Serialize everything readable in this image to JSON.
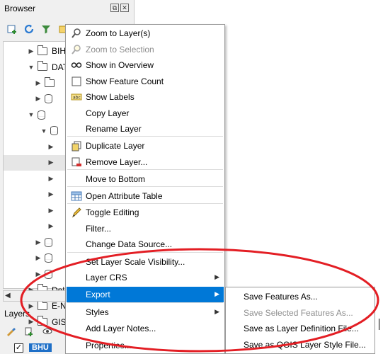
{
  "browser": {
    "title": "Browser",
    "win_buttons": [
      "⧉",
      "✕"
    ],
    "tree": [
      {
        "label": "BIH",
        "icon": "folder-icon",
        "arrow": "▶"
      },
      {
        "label": "DAT",
        "icon": "folder-icon",
        "arrow": "▼"
      },
      {
        "label": "",
        "icon": "folder-icon",
        "arrow": "▶"
      },
      {
        "label": "",
        "icon": "database-icon",
        "arrow": "▶"
      },
      {
        "label": "",
        "icon": "database-icon",
        "arrow": "▼"
      },
      {
        "label": "",
        "icon": "database-icon",
        "arrow": "▼"
      },
      {
        "label": "",
        "icon": "",
        "arrow": "▶"
      },
      {
        "label": "",
        "icon": "",
        "arrow": "▶"
      },
      {
        "label": "",
        "icon": "",
        "arrow": "▶"
      },
      {
        "label": "",
        "icon": "",
        "arrow": "▶"
      },
      {
        "label": "",
        "icon": "",
        "arrow": "▶"
      },
      {
        "label": "",
        "icon": "",
        "arrow": "▶"
      },
      {
        "label": "",
        "icon": "database-icon",
        "arrow": "▶"
      },
      {
        "label": "",
        "icon": "database-icon",
        "arrow": "▶"
      },
      {
        "label": "",
        "icon": "database-icon",
        "arrow": "▶"
      },
      {
        "label": "Dol",
        "icon": "folder-icon",
        "arrow": "▶"
      },
      {
        "label": "E-N",
        "icon": "folder-icon",
        "arrow": "▶"
      },
      {
        "label": "GIS",
        "icon": "folder-icon",
        "arrow": "▶"
      }
    ]
  },
  "layers": {
    "title": "Layers",
    "layer_name": "BHU",
    "checked": "✓"
  },
  "context_menu": {
    "items": [
      {
        "label": "Zoom to Layer(s)",
        "icon": "zoom-icon",
        "disabled": false
      },
      {
        "label": "Zoom to Selection",
        "icon": "zoom-selection-icon",
        "disabled": true
      },
      {
        "label": "Show in Overview",
        "icon": "overview-icon",
        "disabled": false
      },
      {
        "label": "Show Feature Count",
        "icon": "checkbox-icon",
        "disabled": false
      },
      {
        "label": "Show Labels",
        "icon": "labels-icon",
        "disabled": false
      },
      {
        "label": "Copy Layer",
        "icon": "",
        "disabled": false
      },
      {
        "label": "Rename Layer",
        "icon": "",
        "disabled": false
      },
      {
        "label": "Duplicate Layer",
        "icon": "duplicate-icon",
        "disabled": false
      },
      {
        "label": "Remove Layer...",
        "icon": "remove-icon",
        "disabled": false
      },
      {
        "label": "Move to Bottom",
        "icon": "",
        "disabled": false
      },
      {
        "label": "Open Attribute Table",
        "icon": "table-icon",
        "disabled": false
      },
      {
        "label": "Toggle Editing",
        "icon": "pencil-icon",
        "disabled": false
      },
      {
        "label": "Filter...",
        "icon": "",
        "disabled": false
      },
      {
        "label": "Change Data Source...",
        "icon": "",
        "disabled": false
      },
      {
        "label": "Set Layer Scale Visibility...",
        "icon": "",
        "disabled": false
      },
      {
        "label": "Layer CRS",
        "icon": "",
        "disabled": false,
        "submenu": true
      },
      {
        "label": "Export",
        "icon": "",
        "disabled": false,
        "submenu": true,
        "active": true
      },
      {
        "label": "Styles",
        "icon": "",
        "disabled": false,
        "submenu": true
      },
      {
        "label": "Add Layer Notes...",
        "icon": "",
        "disabled": false
      },
      {
        "label": "Properties...",
        "icon": "",
        "disabled": false
      }
    ]
  },
  "export_submenu": {
    "items": [
      {
        "label": "Save Features As...",
        "disabled": false
      },
      {
        "label": "Save Selected Features As...",
        "disabled": true
      },
      {
        "label": "Save as Layer Definition File...",
        "disabled": false
      },
      {
        "label": "Save as QGIS Layer Style File...",
        "disabled": false
      }
    ]
  },
  "colors": {
    "highlight": "#0078d7",
    "annotation": "#e31e24",
    "disabled_text": "#8e8e8e"
  }
}
